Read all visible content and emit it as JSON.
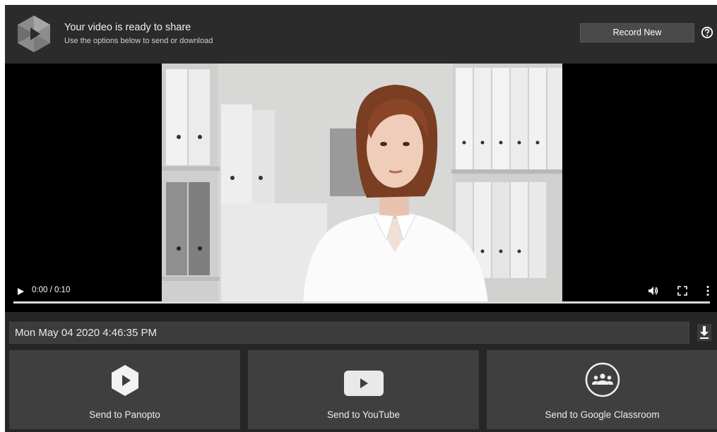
{
  "header": {
    "title": "Your video is ready to share",
    "subtitle": "Use the options below to send or download",
    "record_button": "Record New"
  },
  "player": {
    "time": "0:00 / 0:10",
    "progress": 0.0
  },
  "recording": {
    "title": "Mon May 04 2020 4:46:35 PM"
  },
  "share_options": [
    {
      "label": "Send to Panopto",
      "icon": "panopto-icon"
    },
    {
      "label": "Send to YouTube",
      "icon": "youtube-icon"
    },
    {
      "label": "Send to Google Classroom",
      "icon": "google-classroom-icon"
    }
  ],
  "colors": {
    "background": "#262626",
    "header": "#2b2b2b",
    "button": "#4a4a4a",
    "tile": "#3f3f3f"
  }
}
